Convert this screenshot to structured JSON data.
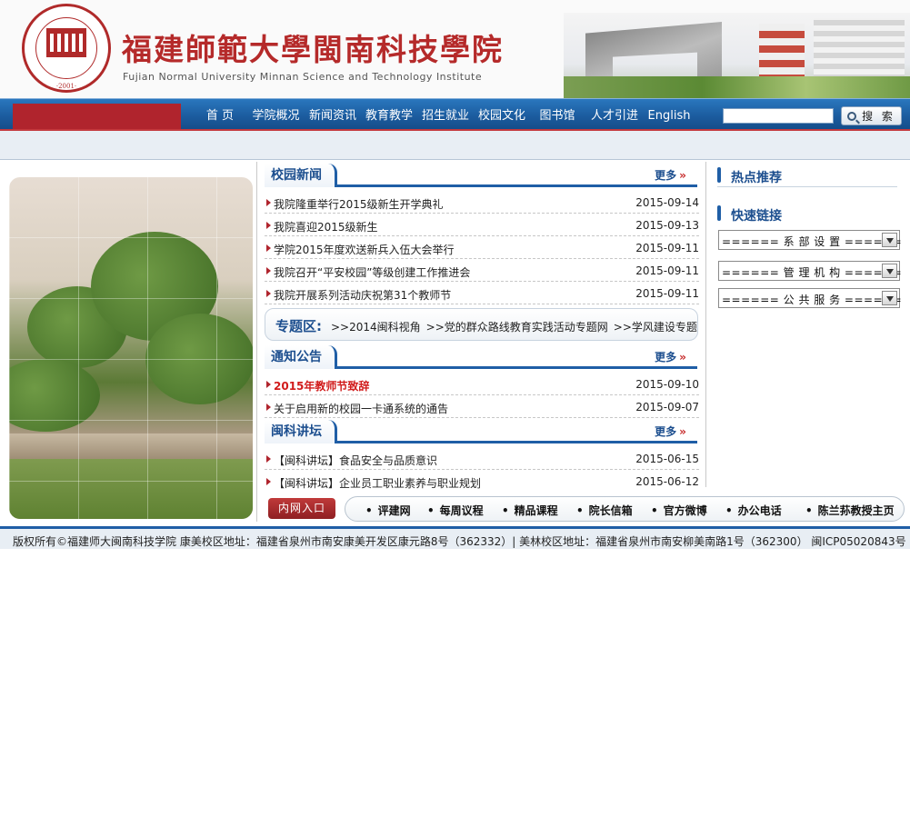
{
  "header": {
    "title_cn": "福建師範大學閩南科技學院",
    "title_en": "Fujian Normal University Minnan Science and Technology Institute",
    "logo_year": "·2001·"
  },
  "nav": {
    "items": [
      "首 页",
      "学院概况",
      "新闻资讯",
      "教育教学",
      "招生就业",
      "校园文化",
      "图书馆",
      "人才引进",
      "English"
    ],
    "search_value": "",
    "search_button": "搜 索"
  },
  "campus_news": {
    "title": "校园新闻",
    "more": "更多",
    "items": [
      {
        "title": "我院隆重举行2015级新生开学典礼",
        "date": "2015-09-14"
      },
      {
        "title": "我院喜迎2015级新生",
        "date": "2015-09-13"
      },
      {
        "title": "学院2015年度欢送新兵入伍大会举行",
        "date": "2015-09-11"
      },
      {
        "title": "我院召开“平安校园”等级创建工作推进会",
        "date": "2015-09-11"
      },
      {
        "title": "我院开展系列活动庆祝第31个教师节",
        "date": "2015-09-11"
      }
    ]
  },
  "special": {
    "label": "专题区:",
    "links": [
      ">>2014闽科视角",
      ">>党的群众路线教育实践活动专题网",
      ">>学风建设专题"
    ]
  },
  "notices": {
    "title": "通知公告",
    "more": "更多",
    "items": [
      {
        "title": "2015年教师节致辞",
        "date": "2015-09-10",
        "highlight": true
      },
      {
        "title": "关于启用新的校园一卡通系统的通告",
        "date": "2015-09-07",
        "highlight": false
      }
    ]
  },
  "lectures": {
    "title": "闽科讲坛",
    "more": "更多",
    "items": [
      {
        "title": "【闽科讲坛】食品安全与品质意识",
        "date": "2015-06-15"
      },
      {
        "title": "【闽科讲坛】企业员工职业素养与职业规划",
        "date": "2015-06-12"
      }
    ]
  },
  "right": {
    "hot_title": "热点推荐",
    "quick_title": "快速链接",
    "selects": [
      "====== 系 部 设 置 ======",
      "====== 管 理 机 构 ======",
      "====== 公 共 服 务 ======"
    ]
  },
  "bottom": {
    "intranet": "内网入口",
    "links": [
      "评建网",
      "每周议程",
      "精品课程",
      "院长信箱",
      "官方微博",
      "办公电话",
      "陈兰荪教授主页"
    ]
  },
  "footer": {
    "text": "版权所有©福建师大闽南科技学院 康美校区地址：福建省泉州市南安康美开发区康元路8号（362332）| 美林校区地址：福建省泉州市南安柳美南路1号（362300） 闽ICP05020843号"
  },
  "colors": {
    "brand_red": "#b0242d",
    "nav_blue": "#1f5ea6",
    "title_blue": "#1d4f8f"
  }
}
